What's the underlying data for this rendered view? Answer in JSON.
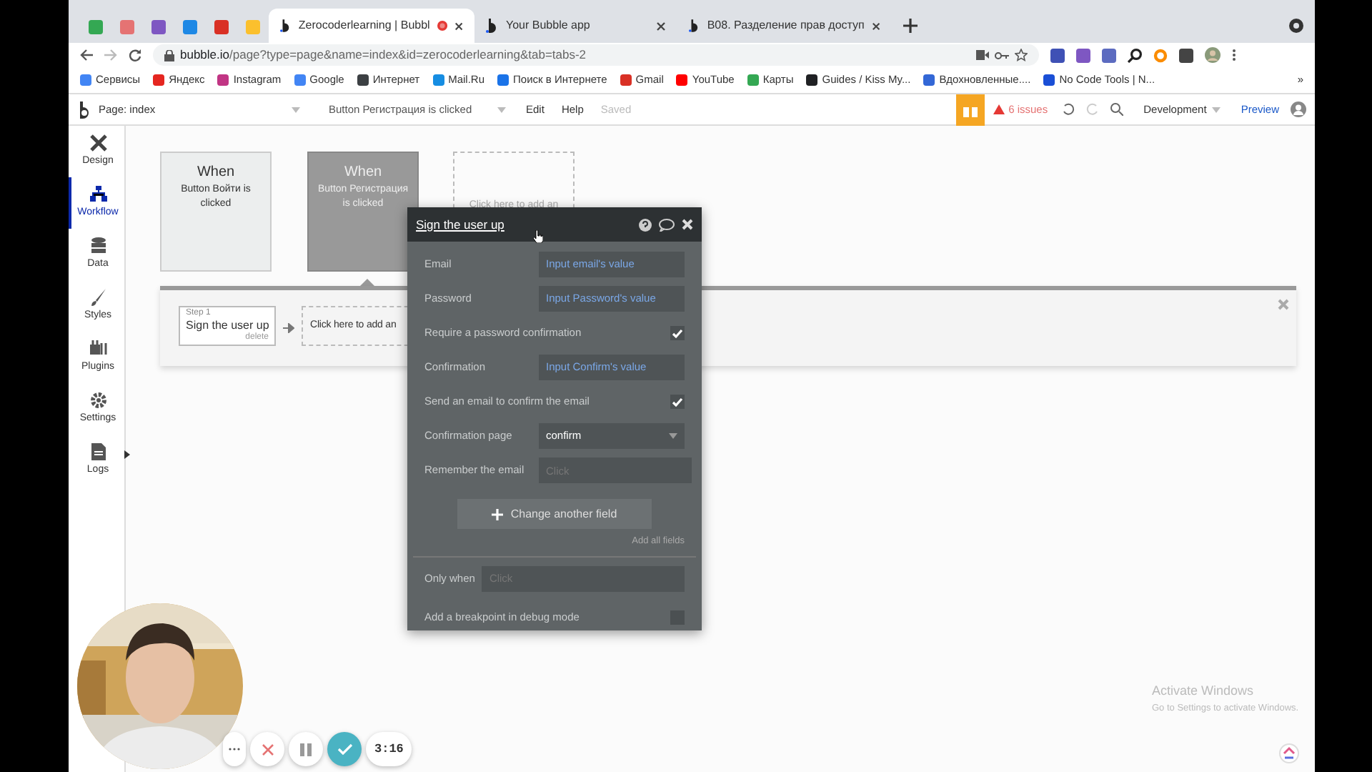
{
  "browser": {
    "tabs": [
      {
        "label": "Zerocoderlearning | Bubbl",
        "selected": true,
        "recording": true
      },
      {
        "label": "Your Bubble app",
        "selected": false,
        "recording": false
      },
      {
        "label": "B08. Разделение прав доступ",
        "selected": false,
        "recording": false
      }
    ],
    "url": {
      "host": "bubble.io",
      "path": "/page?type=page&name=index&id=zerocoderlearning&tab=tabs-2"
    },
    "bookmarks": [
      {
        "label": "Сервисы",
        "color": "#4285f4"
      },
      {
        "label": "Яндекс",
        "color": "#e52620"
      },
      {
        "label": "Instagram",
        "color": "#c13584"
      },
      {
        "label": "Google",
        "color": "#4285f4"
      },
      {
        "label": "Интернет",
        "color": "#3c4043"
      },
      {
        "label": "Mail.Ru",
        "color": "#168de2"
      },
      {
        "label": "Поиск в Интернете",
        "color": "#1a73e8"
      },
      {
        "label": "Gmail",
        "color": "#d93025"
      },
      {
        "label": "YouTube",
        "color": "#ff0000"
      },
      {
        "label": "Карты",
        "color": "#34a853"
      },
      {
        "label": "Guides / Kiss My...",
        "color": "#202124"
      },
      {
        "label": "Вдохновленные....",
        "color": "#3367d6"
      },
      {
        "label": "No Code Tools | N...",
        "color": "#1a4fd6"
      }
    ],
    "bookmarks_more": "»"
  },
  "editor": {
    "page": "Page: index",
    "workflow": "Button Регистрация is clicked",
    "menu": [
      "Edit",
      "Help"
    ],
    "save_status": "Saved",
    "issues": "6 issues",
    "environment": "Development",
    "preview": "Preview"
  },
  "sidebar": {
    "items": [
      {
        "label": "Design",
        "selected": false
      },
      {
        "label": "Workflow",
        "selected": true
      },
      {
        "label": "Data",
        "selected": false
      },
      {
        "label": "Styles",
        "selected": false
      },
      {
        "label": "Plugins",
        "selected": false
      },
      {
        "label": "Settings",
        "selected": false
      },
      {
        "label": "Logs",
        "selected": false
      }
    ]
  },
  "events": [
    {
      "title": "When",
      "text": "Button Войти is clicked",
      "selected": false
    },
    {
      "title": "When",
      "text": "Button Регистрация is clicked",
      "selected": true
    }
  ],
  "add_event": "Click here to add an",
  "steps": [
    {
      "step": "Step 1",
      "name": "Sign the user up",
      "delete": "delete"
    }
  ],
  "add_action": "Click here to add an",
  "popup": {
    "title": "Sign the user up",
    "fields": [
      {
        "kind": "expression",
        "label": "Email",
        "value": "Input email's value"
      },
      {
        "kind": "expression",
        "label": "Password",
        "value": "Input Password's value"
      },
      {
        "kind": "checkbox",
        "label": "Require a password confirmation",
        "checked": true
      },
      {
        "kind": "expression",
        "label": "Confirmation",
        "value": "Input Confirm's value"
      },
      {
        "kind": "checkbox",
        "label": "Send an email to confirm the email",
        "checked": true
      },
      {
        "kind": "dropdown",
        "label": "Confirmation page",
        "value": "confirm"
      },
      {
        "kind": "empty",
        "label": "Remember the email",
        "placeholder": "Click"
      }
    ],
    "change_button": "Change another field",
    "add_all": "Add all fields",
    "only_when": {
      "label": "Only when",
      "placeholder": "Click"
    },
    "breakpoint": {
      "label": "Add a breakpoint in debug mode",
      "checked": false
    }
  },
  "recorder": {
    "time": "3:16"
  },
  "activation": {
    "title": "Activate Windows",
    "text": "Go to Settings to activate Windows."
  }
}
